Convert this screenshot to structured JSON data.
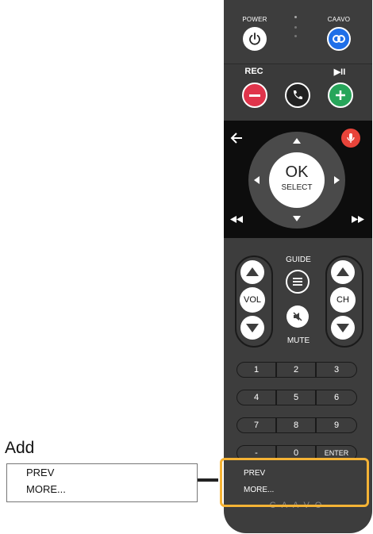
{
  "remote": {
    "power_label": "POWER",
    "caavo_label": "CAAVO",
    "rec_label": "REC",
    "play_pause_label": "▶II",
    "ok_label": "OK",
    "select_label": "SELECT",
    "guide_label": "GUIDE",
    "mute_label": "MUTE",
    "vol_label": "VOL",
    "ch_label": "CH",
    "keypad": [
      "1",
      "2",
      "3",
      "4",
      "5",
      "6",
      "7",
      "8",
      "9",
      "-",
      "0",
      "ENTER"
    ],
    "brand": "CAAVO",
    "colors": {
      "body": "#3d3d3d",
      "caavo_blue": "#1e6fe8",
      "rec_red": "#e0344b",
      "add_green": "#27a55a",
      "mic_red": "#e8443a",
      "highlight": "#f5b335"
    }
  },
  "overlay": {
    "items": [
      "PREV",
      "MORE..."
    ]
  },
  "add_panel": {
    "title": "Add",
    "items": [
      "PREV",
      "MORE..."
    ]
  }
}
